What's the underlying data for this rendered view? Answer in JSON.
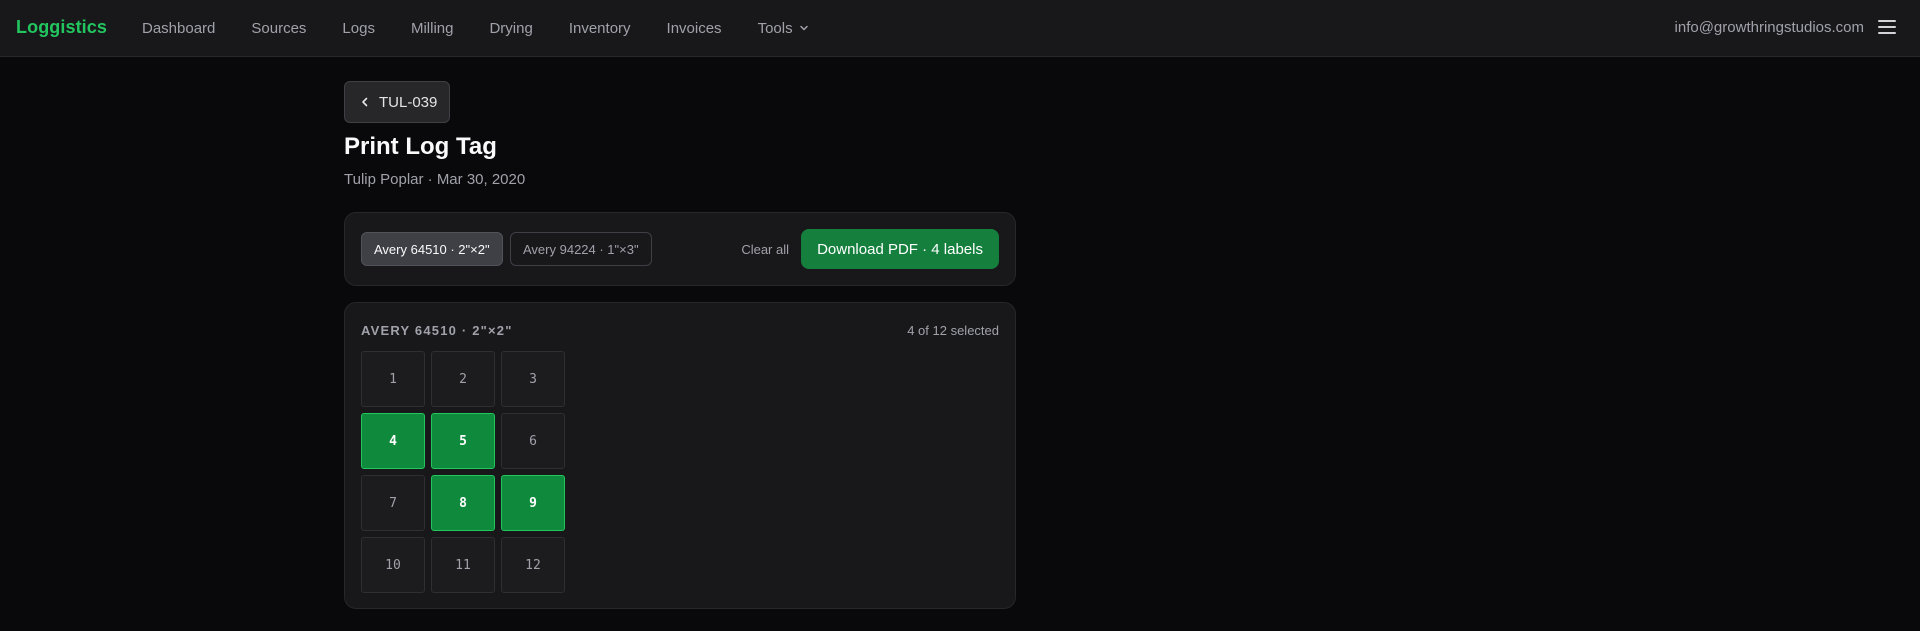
{
  "header": {
    "brand": "Loggistics",
    "nav": [
      {
        "label": "Dashboard"
      },
      {
        "label": "Sources"
      },
      {
        "label": "Logs"
      },
      {
        "label": "Milling"
      },
      {
        "label": "Drying"
      },
      {
        "label": "Inventory"
      },
      {
        "label": "Invoices"
      },
      {
        "label": "Tools",
        "has_dropdown": true
      }
    ],
    "user_email": "info@growthringstudios.com",
    "menu_icon": "hamburger-menu-icon"
  },
  "back_button": {
    "label": "TUL-039",
    "icon": "chevron-left-icon"
  },
  "page": {
    "title": "Print Log Tag",
    "subtitle": "Tulip Poplar · Mar 30, 2020"
  },
  "toolbar": {
    "templates": [
      {
        "label": "Avery 64510 · 2\"×2\"",
        "active": true
      },
      {
        "label": "Avery 94224 · 1\"×3\"",
        "active": false
      }
    ],
    "clear_all": "Clear all",
    "download_label": "Download PDF · 4 labels"
  },
  "sheet": {
    "label": "AVERY 64510 · 2\"×2\"",
    "count_text": "4 of 12 selected",
    "cells": [
      {
        "n": "1",
        "selected": false
      },
      {
        "n": "2",
        "selected": false
      },
      {
        "n": "3",
        "selected": false
      },
      {
        "n": "4",
        "selected": true
      },
      {
        "n": "5",
        "selected": true
      },
      {
        "n": "6",
        "selected": false
      },
      {
        "n": "7",
        "selected": false
      },
      {
        "n": "8",
        "selected": true
      },
      {
        "n": "9",
        "selected": true
      },
      {
        "n": "10",
        "selected": false
      },
      {
        "n": "11",
        "selected": false
      },
      {
        "n": "12",
        "selected": false
      }
    ]
  },
  "colors": {
    "brand": "#22c55e",
    "primary_button": "#15803d",
    "selected_cell": "#0f8a3c",
    "background": "#09090b",
    "panel": "#18181b"
  }
}
